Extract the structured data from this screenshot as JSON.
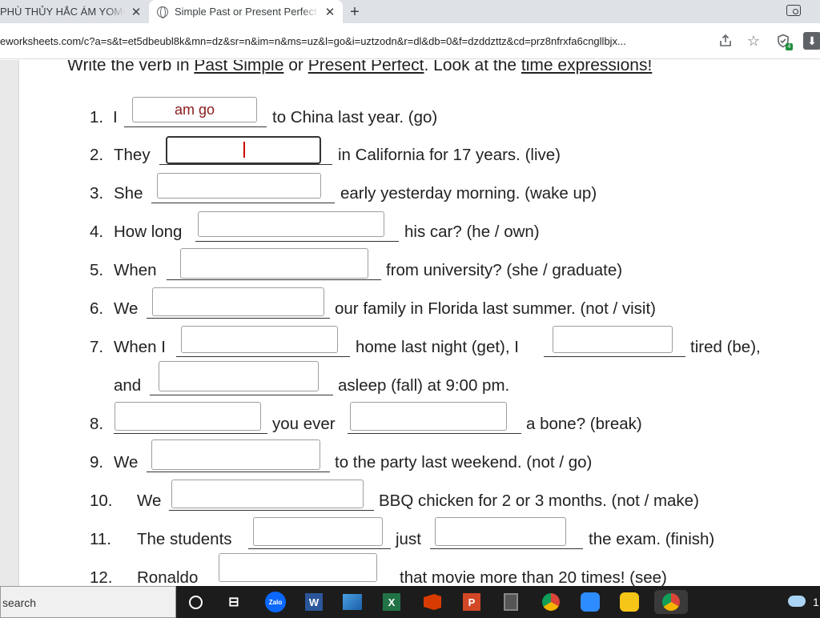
{
  "browser": {
    "tabs": [
      {
        "title": "PHÙ THỦY HẮC ÁM YOMOTSU"
      },
      {
        "title": "Simple Past or Present Perfect"
      }
    ],
    "new_tab_symbol": "+",
    "close_symbol": "✕",
    "url": "eworksheets.com/c?a=s&t=et5dbeubl8k&mn=dz&sr=n&im=n&ms=uz&l=go&i=uztzodn&r=dl&db=0&f=dzddzttz&cd=prz8nfrxfa6cngllbjx...",
    "extension_badge": "4"
  },
  "worksheet": {
    "instruction": {
      "p1": "Write the verb in ",
      "u1": "Past Simple",
      "p2": " or ",
      "u2": "Present Perfect",
      "p3": ". Look at the ",
      "u3": "time expressions!"
    },
    "items": {
      "i1": {
        "num": "1.",
        "a": "I",
        "b": "to China last year. (go)",
        "value": "am go"
      },
      "i2": {
        "num": "2.",
        "a": "They",
        "b": "in California for 17 years. (live)",
        "value": ""
      },
      "i3": {
        "num": "3.",
        "a": "She",
        "b": "early yesterday morning. (wake up)",
        "value": ""
      },
      "i4": {
        "num": "4.",
        "a": "How long",
        "b": "his car? (he / own)",
        "value": ""
      },
      "i5": {
        "num": "5.",
        "a": "When",
        "b": "from university? (she / graduate)",
        "value": ""
      },
      "i6": {
        "num": "6.",
        "a": "We",
        "b": "our family in Florida last summer. (not / visit)",
        "value": ""
      },
      "i7": {
        "num": "7.",
        "a": "When I",
        "b": "home last night (get), I",
        "c": "tired (be),",
        "value": "",
        "value2": ""
      },
      "i7b": {
        "a": "and",
        "b": "asleep (fall) at 9:00 pm.",
        "value": ""
      },
      "i8": {
        "num": "8.",
        "b": "you ever",
        "c": "a bone? (break)",
        "value": "",
        "value2": ""
      },
      "i9": {
        "num": "9.",
        "a": "We",
        "b": "to the party last weekend. (not / go)",
        "value": ""
      },
      "i10": {
        "num": "10.",
        "a": "We",
        "b": "BBQ chicken for 2 or 3 months. (not  / make)",
        "value": ""
      },
      "i11": {
        "num": "11.",
        "a": "The students",
        "b": "just",
        "c": "the exam. (finish)",
        "value": "",
        "value2": ""
      },
      "i12": {
        "num": "12.",
        "a": "Ronaldo",
        "b": "that movie more than 20 times! (see)",
        "value": ""
      }
    }
  },
  "taskbar": {
    "search_label": "search",
    "apps": [
      "search-circle",
      "task-view",
      "Zalo",
      "Word",
      "Photos",
      "Excel",
      "Office",
      "PowerPoint",
      "Calculator",
      "Chrome",
      "Zoom",
      "Messenger",
      "Chrome-active"
    ],
    "zalo_label": "Zalo",
    "word_label": "W",
    "excel_label": "X",
    "ppt_label": "P",
    "tray_text": "1"
  }
}
